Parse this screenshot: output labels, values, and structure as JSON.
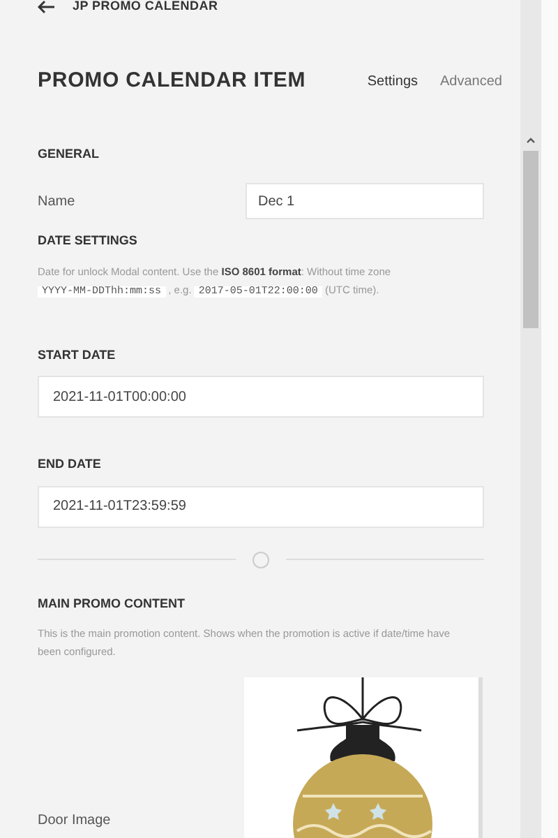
{
  "breadcrumb": {
    "label": "JP PROMO CALENDAR"
  },
  "title": "PROMO CALENDAR ITEM",
  "tabs": [
    {
      "label": "Settings",
      "selected": true
    },
    {
      "label": "Advanced",
      "selected": false
    }
  ],
  "general": {
    "heading": "GENERAL",
    "name_label": "Name",
    "name_value": "Dec 1"
  },
  "date_settings": {
    "heading": "DATE SETTINGS",
    "description": "Date for unlock Modal content. Use the **ISO 8601 format**: Without time zone",
    "format_code": "YYYY-MM-DDThh:mm:ss",
    "example_prefix": ", e.g.",
    "example_code": "2017-05-01T22:00:00",
    "example_suffix": "(UTC time)."
  },
  "start_date": {
    "label": "START DATE",
    "value": "2021-11-01T00:00:00"
  },
  "end_date": {
    "label": "END DATE",
    "value": "2021-11-01T23:59:59"
  },
  "main_promo": {
    "heading": "MAIN PROMO CONTENT",
    "description": "This is the main promotion content. Shows when the promotion is active if date/time have been configured.",
    "door_image_label": "Door Image"
  }
}
